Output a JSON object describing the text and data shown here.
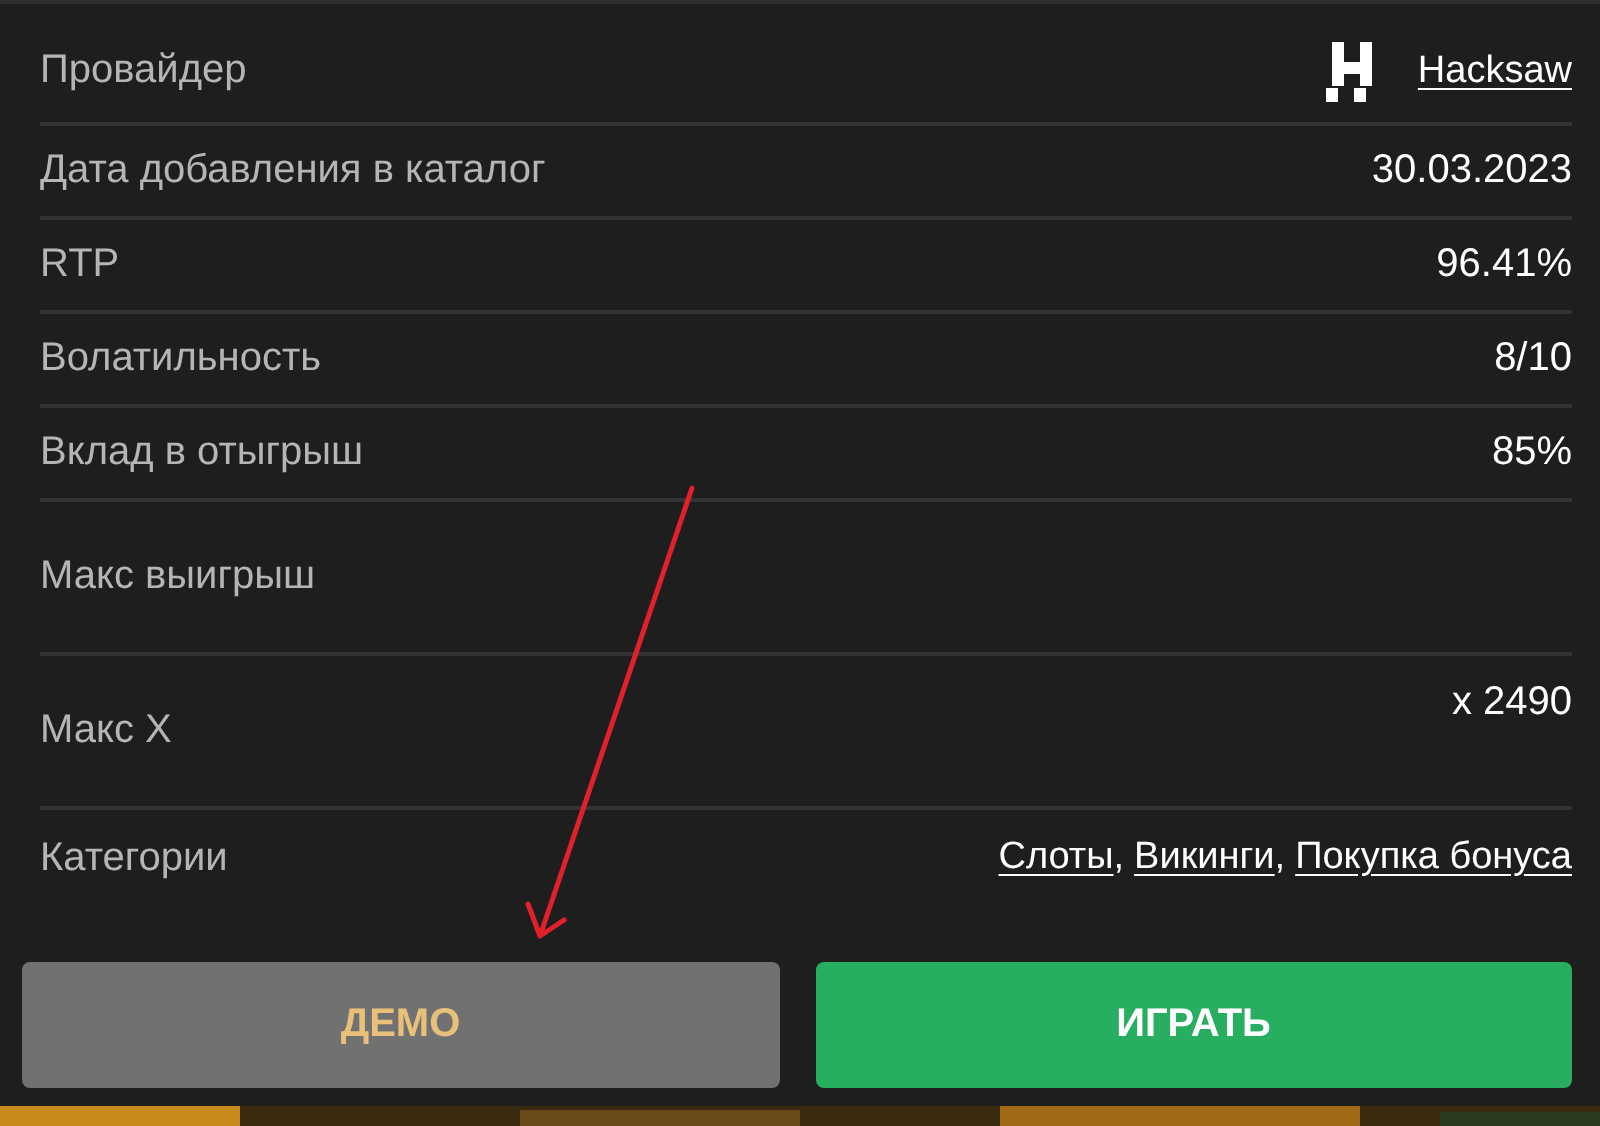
{
  "rows": [
    {
      "label": "Провайдер",
      "kind": "provider",
      "value": "Hacksaw"
    },
    {
      "label": "Дата добавления в каталог",
      "kind": "text",
      "value": "30.03.2023"
    },
    {
      "label": "RTP",
      "kind": "text",
      "value": "96.41%"
    },
    {
      "label": "Волатильность",
      "kind": "text",
      "value": "8/10"
    },
    {
      "label": "Вклад в отыгрыш",
      "kind": "text",
      "value": "85%"
    },
    {
      "label": "Макс выигрыш",
      "kind": "empty"
    },
    {
      "label": "Макс X",
      "kind": "top",
      "value": "x 2490"
    },
    {
      "label": "Категории",
      "kind": "links",
      "links": [
        "Слоты",
        "Викинги",
        "Покупка бонуса"
      ],
      "separator": ","
    }
  ],
  "buttons": [
    {
      "label": "ДЕМО",
      "kind": "secondary"
    },
    {
      "label": "ИГРАТЬ",
      "kind": "primary"
    }
  ]
}
